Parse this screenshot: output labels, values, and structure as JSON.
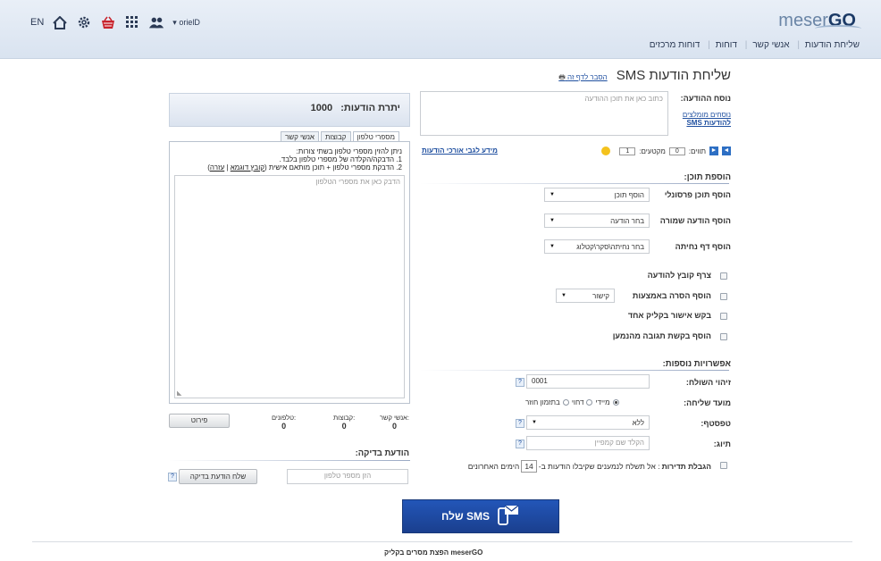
{
  "header": {
    "lang": "EN",
    "user": "orielD",
    "logo_thin": "meser",
    "logo_bold": "GO",
    "nav": [
      "שליחת הודעות",
      "אנשי קשר",
      "דוחות",
      "דוחות מרכזים"
    ]
  },
  "icons": [
    "home-icon",
    "gear-icon",
    "basket-icon",
    "apps-icon",
    "users-icon"
  ],
  "page": {
    "title": "שליחת הודעות SMS",
    "help_link": "הסבר לדף זה"
  },
  "message": {
    "label": "נוסח ההודעה:",
    "placeholder": "כתוב כאן את תוכן ההודעה",
    "templates_link_1": "נוסחים מומלצים",
    "templates_link_2": "להודעות SMS",
    "chars_label": "תווים:",
    "chars_value": "0",
    "segments_label": "מקטעים:",
    "segments_value": "1",
    "long_info_link": "מידע לגבי אורכי הודעות"
  },
  "add_content": {
    "title": "הוספת תוכן:",
    "personal_label": "הוסף תוכן פרסונלי",
    "personal_value": "הוסף תוכן",
    "saved_label": "הוסף הודעה שמורה",
    "saved_value": "בחר הודעה",
    "landing_label": "הוסף דף נחיתה",
    "landing_value": "בחר נחיתה\\סקר\\קטלוג",
    "attach_file": "צרף קובץ להודעה",
    "add_image": "הוסף הסרה באמצעות",
    "image_value": "קישור",
    "one_click": "בקש אישור בקליק אחד",
    "reply_request": "הוסף בקשת תגובה מהנמען"
  },
  "options": {
    "title": "אפשרויות נוספות:",
    "sender_label": "זיהוי השולח:",
    "sender_value": "0001",
    "time_label": "מועד שליחה:",
    "time_now": "מיידי",
    "time_delay": "דחוי",
    "time_recurring": "בתזמון חוזר",
    "form_label": "טפסטף:",
    "form_value": "ללא",
    "tag_label": "תיוג:",
    "tag_placeholder": "הקלד שם קמפיין",
    "limit_bold": "הגבלת תדירות",
    "limit_text": ": אל תשלח לנמענים שקיבלו הודעות ב-",
    "limit_days": "14",
    "limit_suffix": "הימים האחרונים"
  },
  "credits": {
    "label": "יתרת הודעות:",
    "value": "1000"
  },
  "tabs": [
    "מספרי טלפון",
    "קבוצות",
    "אנשי קשר"
  ],
  "recipients": {
    "line1": "ניתן להזין מספרי טלפון בשתי צורות:",
    "line2": "1. הדבקה/הקלדה של מספרי טלפון בלבד.",
    "line3": "2. הדבקת מספרי טלפון + תוכן מותאם אישית (",
    "line3_link1": "קובץ דוגמא",
    "line3_sep": " | ",
    "line3_link2": "עזרה",
    "line3_end": ")",
    "placeholder": "הדבק כאן את מספרי הטלפון"
  },
  "counters": {
    "contacts_label": "אנשי קשר:",
    "contacts_value": "0",
    "groups_label": "קבוצות:",
    "groups_value": "0",
    "phones_label": "טלפונים:",
    "phones_value": "0",
    "detail_button": "פירוט"
  },
  "test": {
    "title": "הודעת בדיקה:",
    "placeholder": "הזן מספר טלפון",
    "button": "שלח הודעת בדיקה"
  },
  "send_button": "שלח SMS",
  "footer": "meserGO הפצת מסרים בקליק"
}
